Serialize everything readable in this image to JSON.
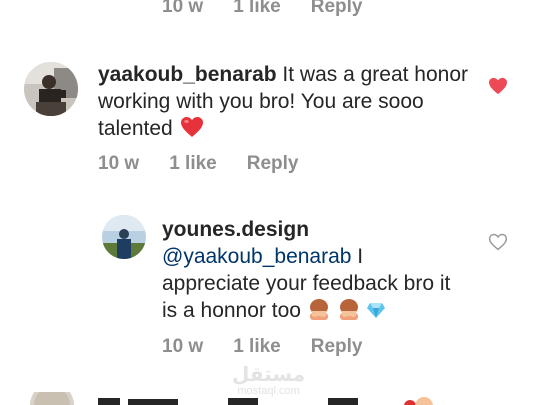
{
  "top_meta": {
    "time": "10 w",
    "likes": "1 like",
    "reply": "Reply"
  },
  "comment1": {
    "username": "yaakoub_benarab",
    "text": " It was a great honor working with you bro! You are sooo talented ",
    "emoji": "heart",
    "meta": {
      "time": "10 w",
      "likes": "1 like",
      "reply": "Reply"
    },
    "liked": true,
    "like_color": "#ed4956"
  },
  "reply1": {
    "username": "younes.design",
    "mention": " @yaakoub_benarab",
    "text": " I appreciate your feedback bro it is a honnor too ",
    "emojis": [
      "person-bowing",
      "person-bowing",
      "gem"
    ],
    "meta": {
      "time": "10 w",
      "likes": "1 like",
      "reply": "Reply"
    },
    "liked": false
  },
  "watermark": {
    "big": "مستقل",
    "small": "mostaql.com"
  }
}
